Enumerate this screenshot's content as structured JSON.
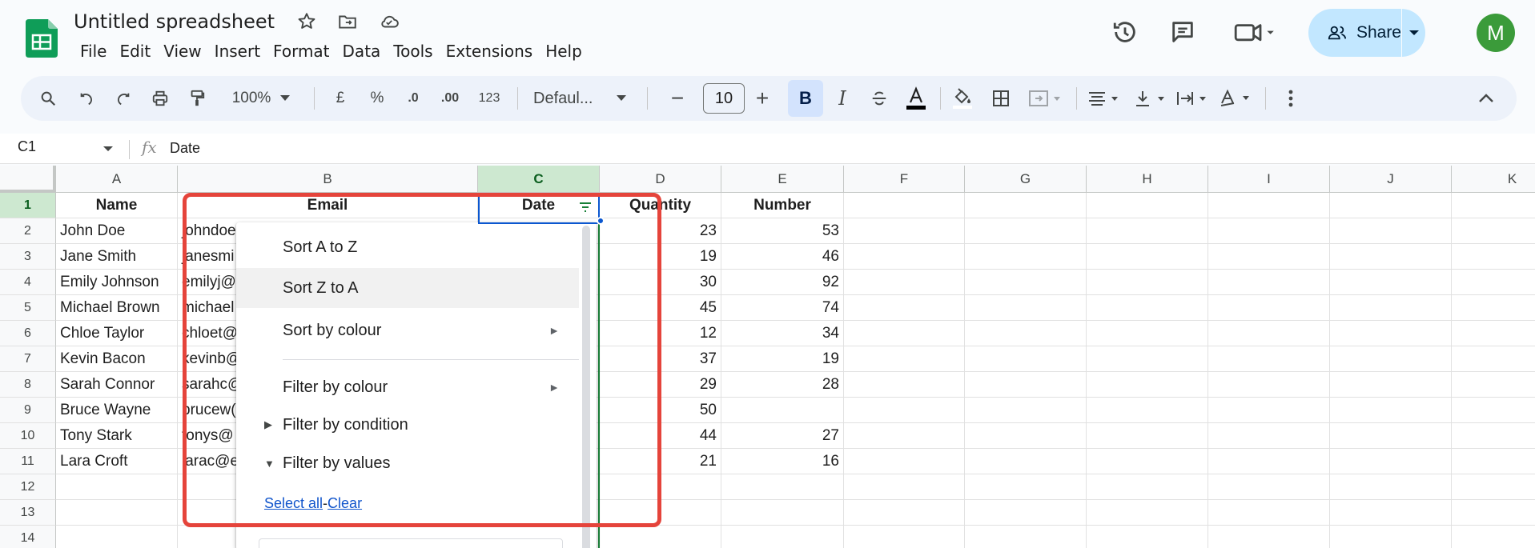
{
  "app": {
    "title": "Untitled spreadsheet",
    "menu": [
      "File",
      "Edit",
      "View",
      "Insert",
      "Format",
      "Data",
      "Tools",
      "Extensions",
      "Help"
    ],
    "share_label": "Share",
    "avatar_letter": "M",
    "accent": "#188038"
  },
  "toolbar": {
    "zoom": "100%",
    "currency": "£",
    "percent": "%",
    "dec_decrease": ".0",
    "dec_increase": ".00",
    "number_format": "123",
    "font": "Defaul...",
    "font_size": "10",
    "bold": "B",
    "italic": "I"
  },
  "formula_bar": {
    "cell_ref": "C1",
    "fx": "fx",
    "value": "Date"
  },
  "grid": {
    "columns": [
      "A",
      "B",
      "C",
      "D",
      "E",
      "F",
      "G",
      "H",
      "I",
      "J",
      "K"
    ],
    "rows": [
      "1",
      "2",
      "3",
      "4",
      "5",
      "6",
      "7",
      "8",
      "9",
      "10",
      "11",
      "12",
      "13",
      "14"
    ],
    "headers": {
      "A": "Name",
      "B": "Email",
      "C": "Date",
      "D": "Quantity",
      "E": "Number"
    },
    "names": [
      "John Doe",
      "Jane Smith",
      "Emily Johnson",
      "Michael Brown",
      "Chloe Taylor",
      "Kevin Bacon",
      "Sarah Connor",
      "Bruce Wayne",
      "Tony Stark",
      "Lara Croft"
    ],
    "emails": [
      "johndoe",
      "janesmi",
      "emilyj@",
      "michael",
      "chloet@",
      "kevinb@",
      "sarahc@",
      "brucew(",
      "tonys@",
      "larac@e"
    ],
    "quantity": [
      "23",
      "19",
      "30",
      "45",
      "12",
      "37",
      "29",
      "50",
      "44",
      "21"
    ],
    "number": [
      "53",
      "46",
      "92",
      "74",
      "34",
      "19",
      "28",
      "",
      "27",
      "16"
    ]
  },
  "filter_menu": {
    "sort_az": "Sort A to Z",
    "sort_za": "Sort Z to A",
    "sort_colour": "Sort by colour",
    "filter_colour": "Filter by colour",
    "filter_condition": "Filter by condition",
    "filter_values": "Filter by values",
    "select_all": "Select all",
    "separator": "-",
    "clear": "Clear"
  }
}
